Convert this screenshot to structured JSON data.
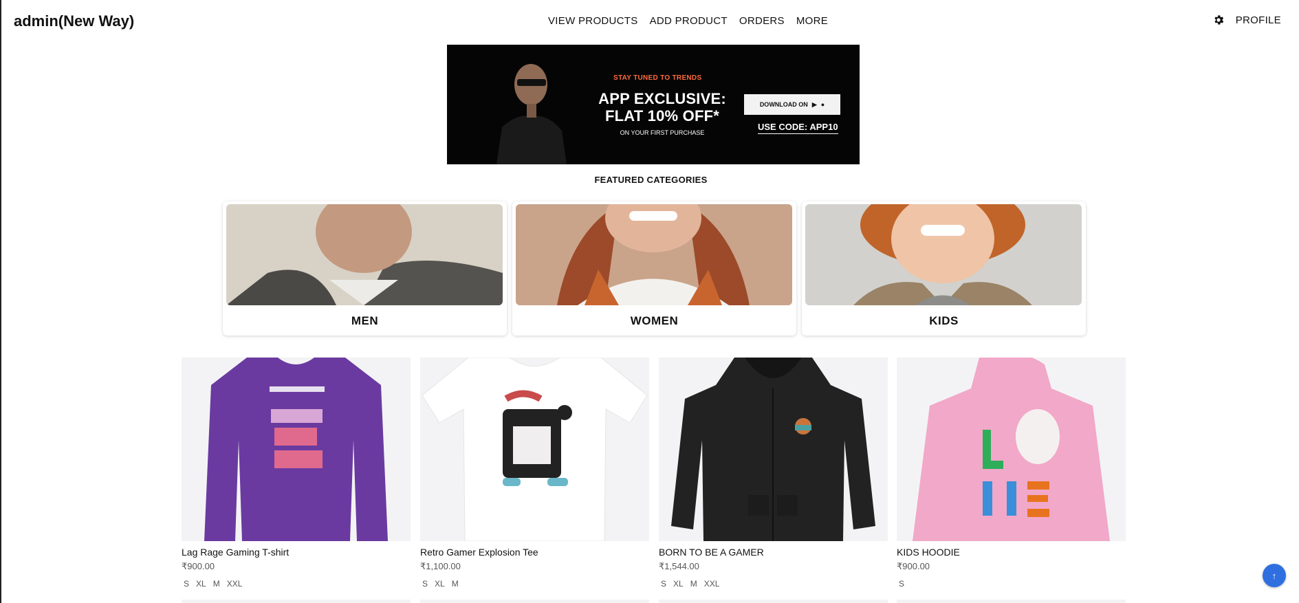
{
  "header": {
    "brand": "admin(New Way)",
    "nav": [
      "VIEW PRODUCTS",
      "ADD PRODUCT",
      "ORDERS",
      "MORE"
    ],
    "profile_label": "PROFILE",
    "settings_icon": "gear-icon"
  },
  "banner": {
    "tagline": "STAY TUNED TO TRENDS",
    "headline_1": "APP EXCLUSIVE:",
    "headline_2": "FLAT 10% OFF*",
    "subline": "ON YOUR FIRST PURCHASE",
    "download_label": "DOWNLOAD ON",
    "code_text": "USE CODE: APP10",
    "accent_color": "#ff6a3d"
  },
  "featured_title": "FEATURED CATEGORIES",
  "categories": [
    {
      "label": "MEN"
    },
    {
      "label": "WOMEN"
    },
    {
      "label": "KIDS"
    }
  ],
  "products": [
    {
      "name": "Lag Rage Gaming T-shirt",
      "price": "₹900.00",
      "sizes": [
        "S",
        "XL",
        "M",
        "XXL"
      ]
    },
    {
      "name": "Retro Gamer Explosion Tee",
      "price": "₹1,100.00",
      "sizes": [
        "S",
        "XL",
        "M"
      ]
    },
    {
      "name": "BORN TO BE A GAMER",
      "price": "₹1,544.00",
      "sizes": [
        "S",
        "XL",
        "M",
        "XXL"
      ]
    },
    {
      "name": "KIDS HOODIE",
      "price": "₹900.00",
      "sizes": [
        "S"
      ]
    }
  ],
  "scroll_top_icon": "arrow-up-icon",
  "colors": {
    "scroll_top": "#2f6fe0",
    "product_bg": "#f3f3f5"
  }
}
